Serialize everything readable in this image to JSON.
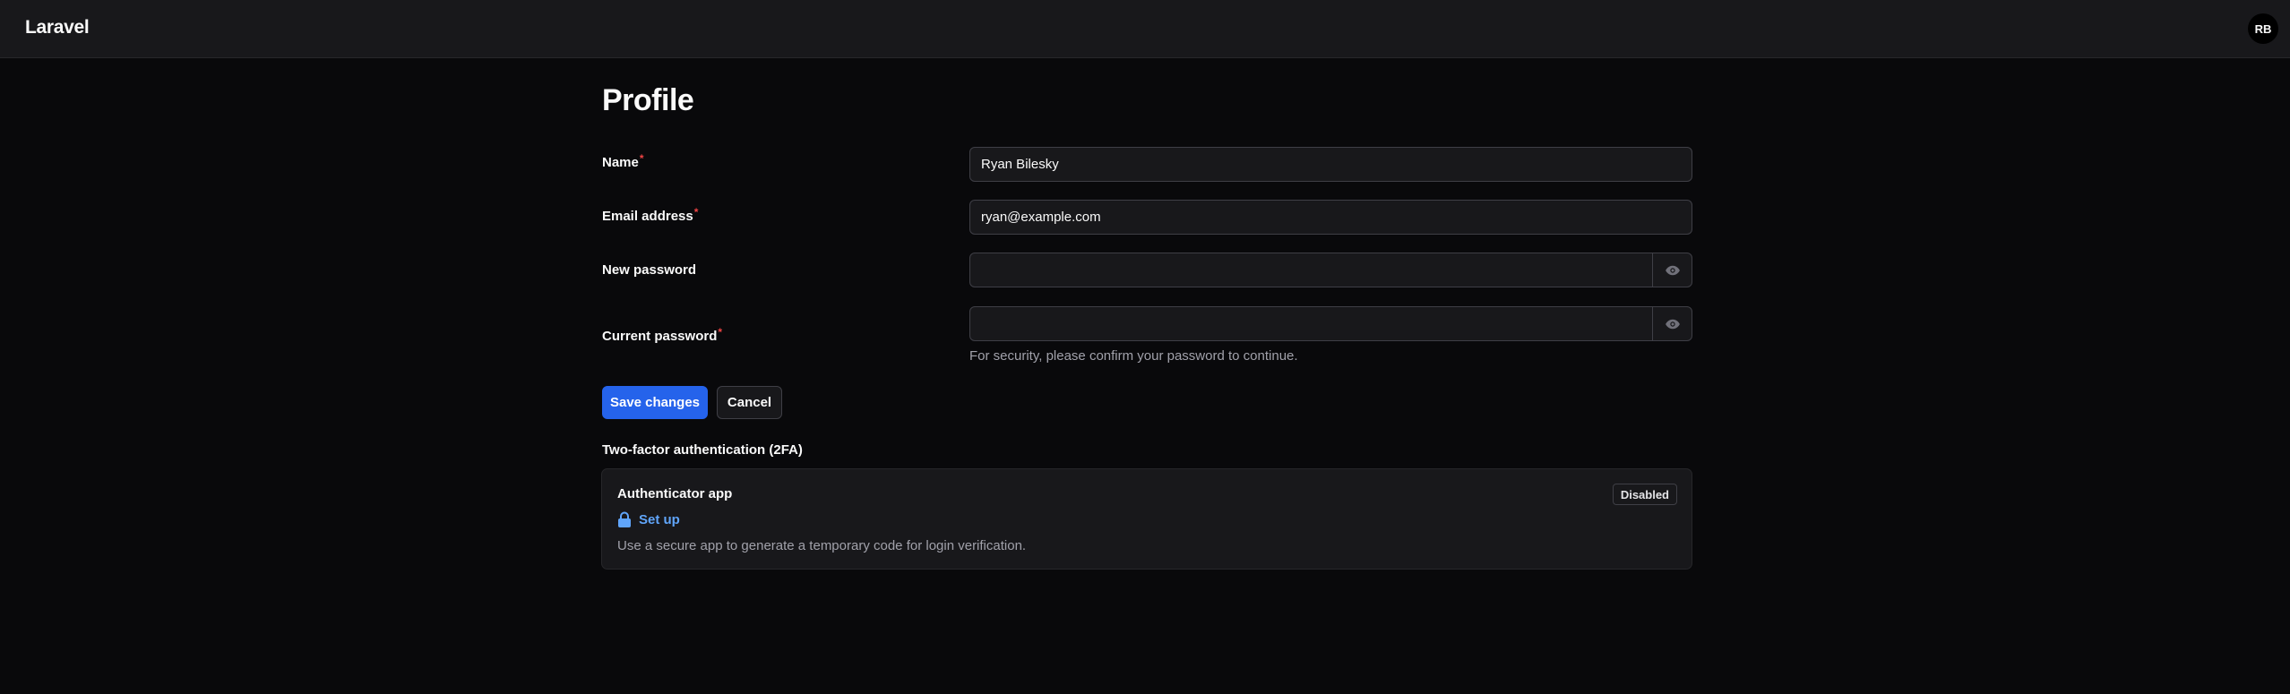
{
  "header": {
    "brand": "Laravel",
    "avatar_initials": "RB"
  },
  "page": {
    "title": "Profile"
  },
  "form": {
    "name": {
      "label": "Name",
      "required_mark": "*",
      "value": "Ryan Bilesky"
    },
    "email": {
      "label": "Email address",
      "required_mark": "*",
      "value": "ryan@example.com"
    },
    "new_password": {
      "label": "New password",
      "value": ""
    },
    "current_password": {
      "label": "Current password",
      "required_mark": "*",
      "value": "",
      "hint": "For security, please confirm your password to continue."
    },
    "save_label": "Save changes",
    "cancel_label": "Cancel"
  },
  "two_factor": {
    "section_title": "Two-factor authentication (2FA)",
    "card_title": "Authenticator app",
    "status": "Disabled",
    "setup_label": "Set up",
    "description": "Use a secure app to generate a temporary code for login verification."
  },
  "icons": {
    "password_toggle": "eye-icon",
    "setup": "lock-icon"
  },
  "colors": {
    "background": "#09090b",
    "surface": "#18181b",
    "border": "#3f3f46",
    "primary": "#2563eb",
    "link": "#60a5fa",
    "required": "#ef4444",
    "muted_text": "#a1a1aa"
  }
}
